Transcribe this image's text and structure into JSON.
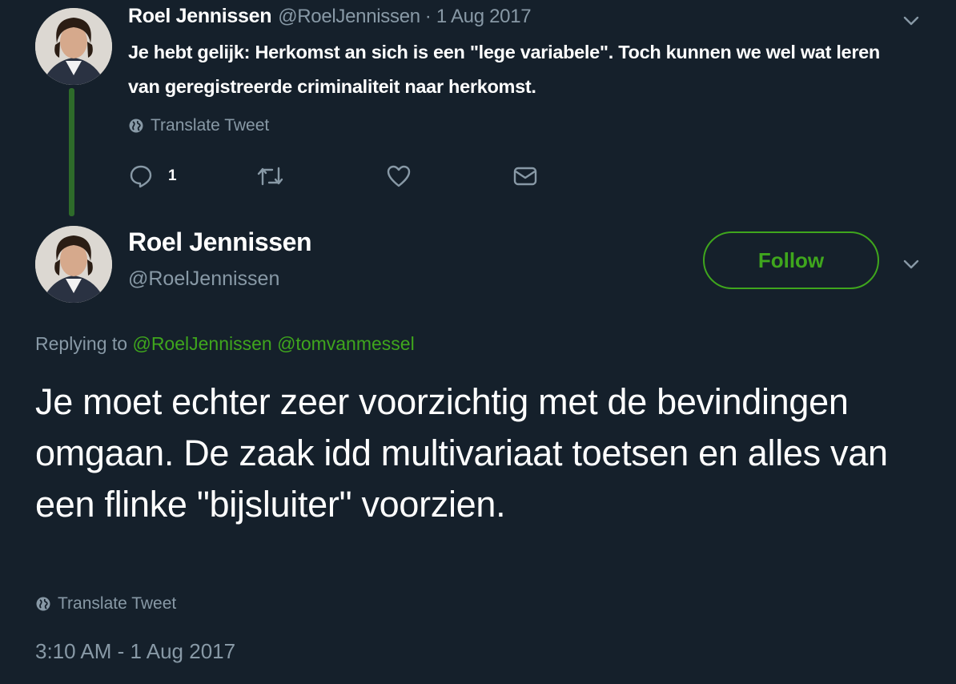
{
  "parent_tweet": {
    "author_name": "Roel Jennissen",
    "author_handle": "@RoelJennissen",
    "date": "· 1 Aug 2017",
    "text": "Je hebt gelijk: Herkomst an sich is een \"lege variabele\". Toch kunnen we wel wat leren van geregistreerde criminaliteit naar herkomst.",
    "translate_label": "Translate Tweet",
    "reply_count": "1",
    "menu_icon": "chevron-down-icon"
  },
  "main_tweet": {
    "author_name": "Roel Jennissen",
    "author_handle": "@RoelJennissen",
    "follow_label": "Follow",
    "replying_prefix": "Replying to",
    "replying_mentions": "@RoelJennissen @tomvanmessel",
    "text": "Je moet echter zeer voorzichtig met de bevindingen omgaan. De zaak idd multivariaat toetsen en alles van een flinke \"bijsluiter\" voorzien.",
    "translate_label": "Translate Tweet",
    "timestamp": "3:10 AM - 1 Aug 2017",
    "menu_icon": "chevron-down-icon"
  },
  "colors": {
    "background": "#15202b",
    "accent": "#3fa61d",
    "secondary_text": "#8899a6",
    "thread_line": "#2e6b2a"
  }
}
